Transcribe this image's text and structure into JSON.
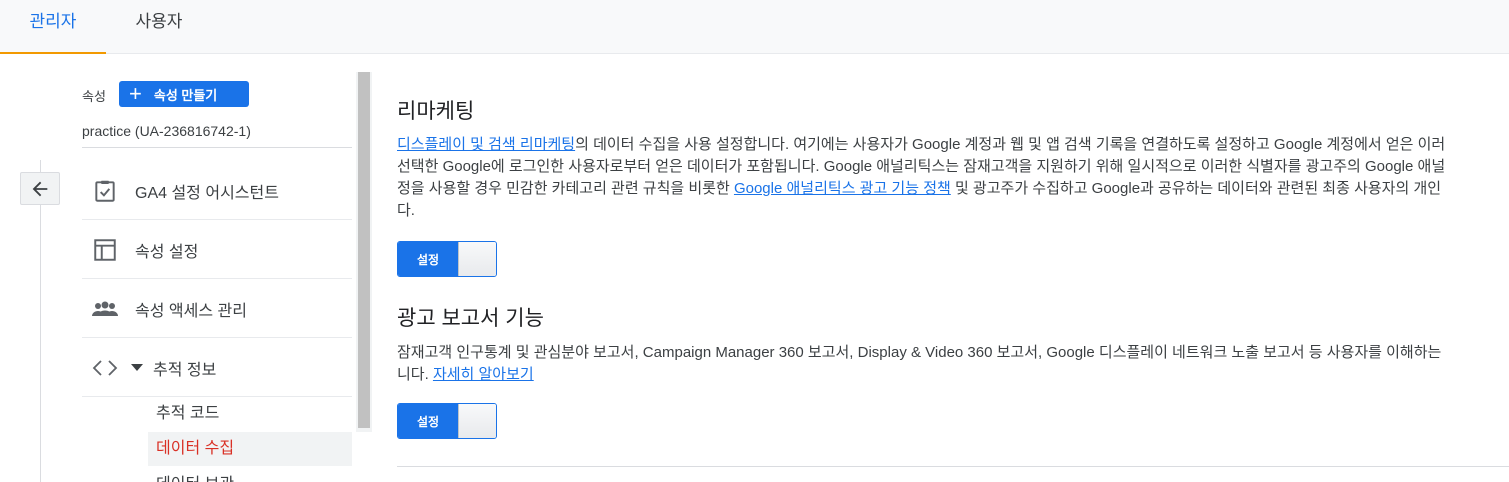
{
  "tabs": [
    {
      "label": "관리자",
      "active": true
    },
    {
      "label": "사용자",
      "active": false
    }
  ],
  "sidebar": {
    "property_label": "속성",
    "create_property_label": "속성 만들기",
    "property_id": "practice (UA-236816742-1)",
    "items": [
      {
        "label": "GA4 설정 어시스턴트",
        "icon": "clipboard-check-icon"
      },
      {
        "label": "속성 설정",
        "icon": "layout-icon"
      },
      {
        "label": "속성 액세스 관리",
        "icon": "people-icon"
      },
      {
        "label": "추적 정보",
        "icon": "code-icon",
        "expanded": true
      }
    ],
    "sub_items": [
      {
        "label": "추적 코드",
        "selected": false
      },
      {
        "label": "데이터 수집",
        "selected": true
      },
      {
        "label": "데이터 보관",
        "selected": false
      }
    ]
  },
  "main": {
    "remarketing": {
      "title": "리마케팅",
      "link1": "디스플레이 및 검색 리마케팅",
      "text1": "의 데이터 수집을 사용 설정합니다. 여기에는 사용자가 Google 계정과 웹 및 앱 검색 기록을 연결하도록 설정하고 Google 계정에서 얻은 이러",
      "line2": "선택한 Google에 로그인한 사용자로부터 얻은 데이터가 포함됩니다. Google 애널리틱스는 잠재고객을 지원하기 위해 일시적으로 이러한 식별자를 광고주의 Google 애널",
      "line3_pre": "정을 사용할 경우 민감한 카테고리 관련 규칙을 비롯한 ",
      "link2": "Google 애널리틱스 광고 기능 정책",
      "line3_post": " 및 광고주가 수집하고 Google과 공유하는 데이터와 관련된 최종 사용자의 개인",
      "line4": "다.",
      "toggle_label": "설정"
    },
    "ads_reporting": {
      "title": "광고 보고서 기능",
      "line1": "잠재고객 인구통계 및 관심분야 보고서, Campaign Manager 360 보고서, Display & Video 360 보고서, Google 디스플레이 네트워크 노출 보고서 등 사용자를 이해하는",
      "line2_pre": "니다. ",
      "link": "자세히 알아보기",
      "toggle_label": "설정"
    }
  },
  "colors": {
    "accent": "#1a73e8",
    "active_tab_underline": "#f29900",
    "selected_item_text": "#d93025"
  }
}
